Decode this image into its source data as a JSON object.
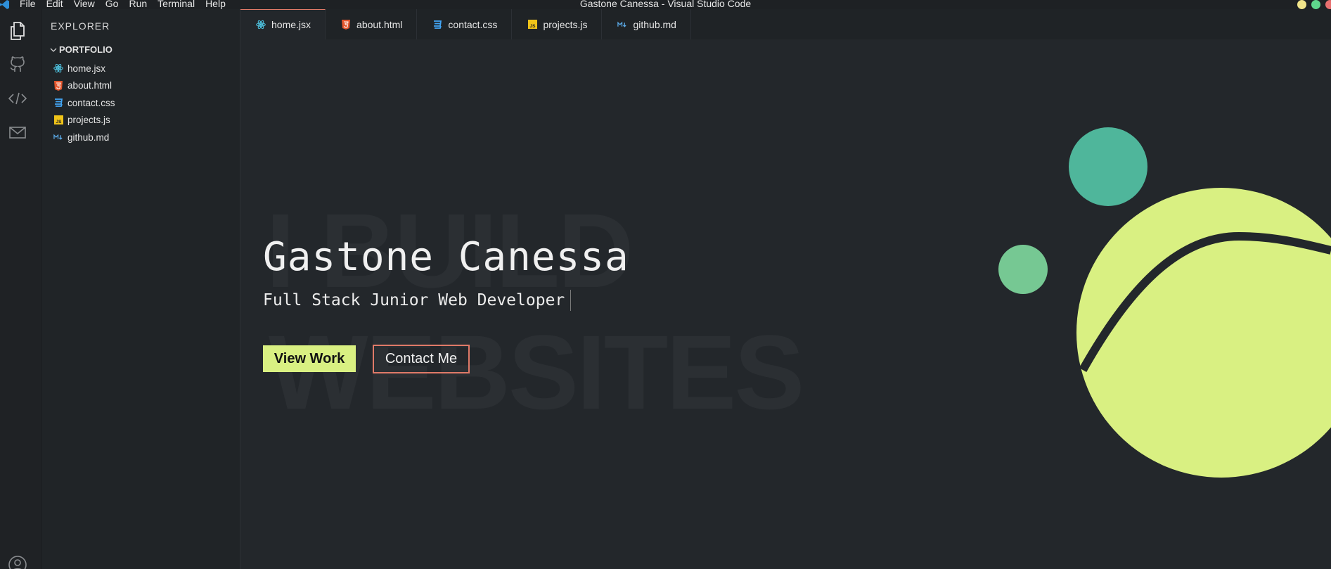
{
  "window": {
    "title": "Gastone Canessa - Visual Studio Code",
    "menu": [
      "File",
      "Edit",
      "View",
      "Go",
      "Run",
      "Terminal",
      "Help"
    ]
  },
  "activity_bar": {
    "icons": [
      "files-icon",
      "github-icon",
      "code-icon",
      "mail-icon",
      "account-icon"
    ]
  },
  "explorer": {
    "title": "EXPLORER",
    "folder": "PORTFOLIO",
    "files": [
      {
        "name": "home.jsx",
        "icon": "react-icon"
      },
      {
        "name": "about.html",
        "icon": "html-icon"
      },
      {
        "name": "contact.css",
        "icon": "css-icon"
      },
      {
        "name": "projects.js",
        "icon": "js-icon"
      },
      {
        "name": "github.md",
        "icon": "markdown-icon"
      }
    ]
  },
  "tabs": [
    {
      "label": "home.jsx",
      "icon": "react-icon",
      "active": true
    },
    {
      "label": "about.html",
      "icon": "html-icon",
      "active": false
    },
    {
      "label": "contact.css",
      "icon": "css-icon",
      "active": false
    },
    {
      "label": "projects.js",
      "icon": "js-icon",
      "active": false
    },
    {
      "label": "github.md",
      "icon": "markdown-icon",
      "active": false
    }
  ],
  "hero": {
    "background_text_1": "I BUILD",
    "background_text_2": "WEBSITES",
    "name": "Gastone Canessa",
    "subtitle": "Full Stack Junior Web Developer",
    "primary_button": "View Work",
    "secondary_button": "Contact Me"
  },
  "colors": {
    "accent_lime": "#d9f082",
    "accent_teal": "#4fb69b",
    "accent_green": "#76c893",
    "accent_coral": "#e07a68",
    "editor_bg": "#23272b"
  }
}
